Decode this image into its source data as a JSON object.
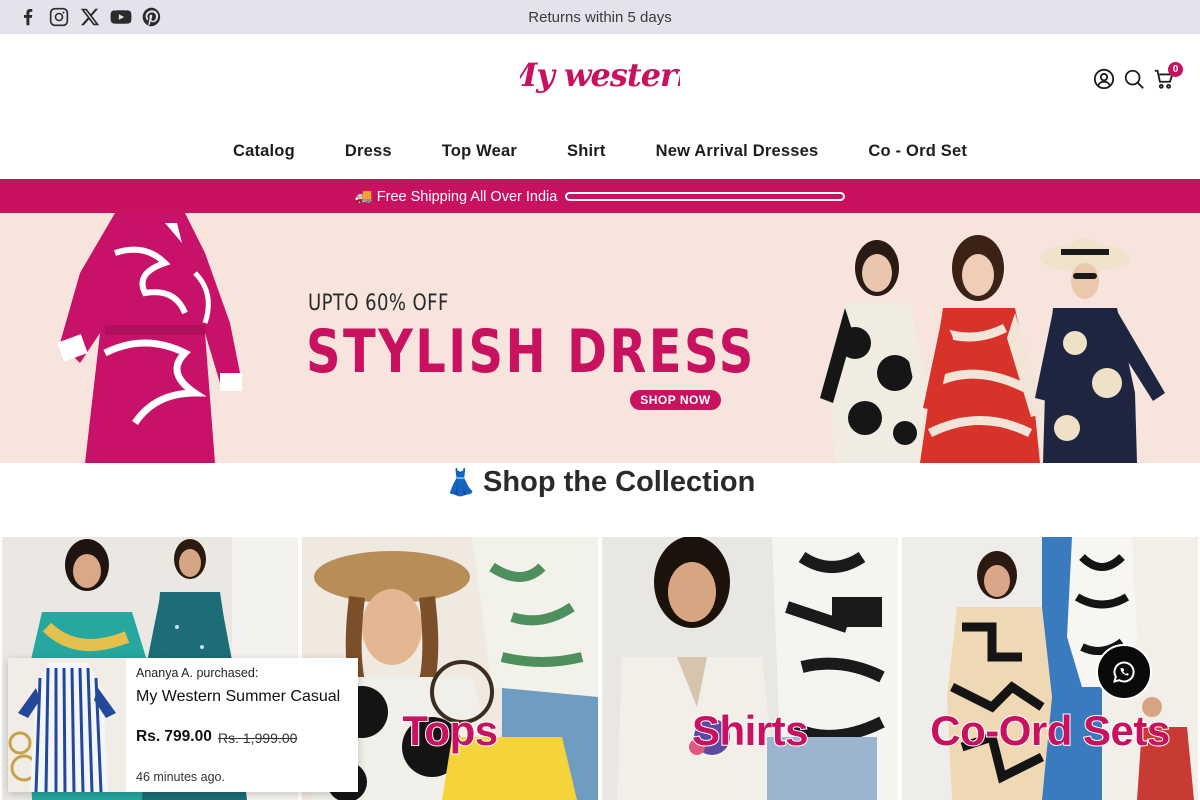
{
  "topbar": {
    "social_icons": [
      "facebook-icon",
      "instagram-icon",
      "x-icon",
      "youtube-icon",
      "pinterest-icon"
    ],
    "announcement": "Returns within 5 days"
  },
  "header": {
    "logo_text": "My western",
    "icons": [
      "account-icon",
      "search-icon",
      "cart-icon"
    ],
    "cart_count": "0"
  },
  "nav": {
    "items": [
      "Catalog",
      "Dress",
      "Top Wear",
      "Shirt",
      "New Arrival Dresses",
      "Co - Ord Set"
    ]
  },
  "shipping_bar": {
    "text": "🚚 Free Shipping All Over India"
  },
  "hero": {
    "offer": "UPTO 60% OFF",
    "title": "STYLISH DRESS",
    "button": "SHOP NOW"
  },
  "collection": {
    "emoji": "👗",
    "title": "Shop the Collection",
    "cards": [
      {
        "label": ""
      },
      {
        "label": "Tops"
      },
      {
        "label": "Shirts"
      },
      {
        "label": "Co-Ord Sets"
      }
    ]
  },
  "popup": {
    "who": "Ananya A. purchased:",
    "product": "My Western Summer Casual",
    "price": "Rs. 799.00",
    "old_price": "Rs. 1,999.00",
    "ago": "46 minutes ago."
  },
  "colors": {
    "brand": "#c8125f",
    "topbar_bg": "#e6e2ec",
    "hero_bg": "#f7e4dd"
  }
}
